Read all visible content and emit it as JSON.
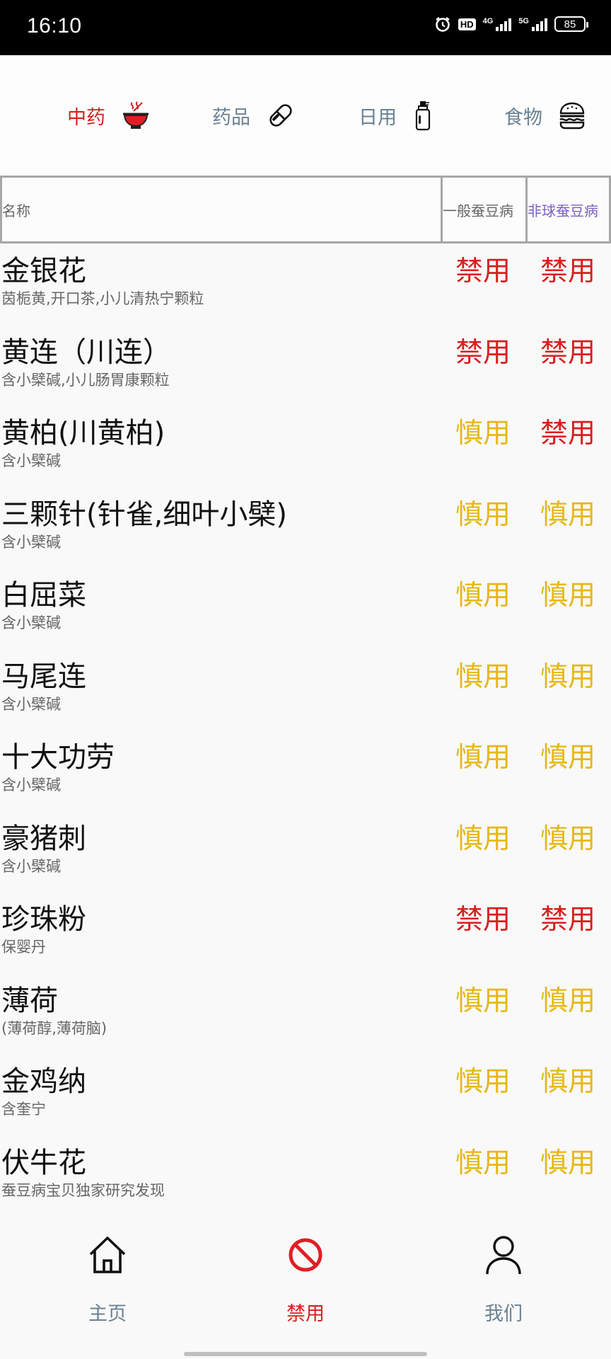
{
  "status": {
    "time": "16:10",
    "hd": "HD",
    "net1": "4G",
    "net2": "5G",
    "battery": "85"
  },
  "categories": [
    {
      "label": "中药",
      "icon": "herbal-bowl-icon",
      "color": "#d61f1f"
    },
    {
      "label": "药品",
      "icon": "pill-capsule-icon",
      "color": "#6a8193"
    },
    {
      "label": "日用",
      "icon": "spray-bottle-icon",
      "color": "#6a8193"
    },
    {
      "label": "食物",
      "icon": "burger-icon",
      "color": "#6a8193"
    }
  ],
  "table_header": {
    "name": "名称",
    "col1": "一般蚕豆病",
    "col2": "非球蚕豆病"
  },
  "colors": {
    "forbidden": "#d81e1e",
    "caution": "#e6b818",
    "col2_header": "#7a5fc7",
    "nav_inactive": "#6a8193",
    "nav_active": "#d61f1f"
  },
  "rows": [
    {
      "name": "金银花",
      "sub": "茵栀黄,开口茶,小儿清热宁颗粒",
      "c1": "禁用",
      "c2": "禁用"
    },
    {
      "name": "黄连（川连）",
      "sub": "含小檗碱,小儿肠胃康颗粒",
      "c1": "禁用",
      "c2": "禁用"
    },
    {
      "name": "黄柏(川黄柏)",
      "sub": "含小檗碱",
      "c1": "慎用",
      "c2": "禁用"
    },
    {
      "name": "三颗针(针雀,细叶小檗)",
      "sub": "含小檗碱",
      "c1": "慎用",
      "c2": "慎用"
    },
    {
      "name": "白屈菜",
      "sub": "含小檗碱",
      "c1": "慎用",
      "c2": "慎用"
    },
    {
      "name": "马尾连",
      "sub": "含小檗碱",
      "c1": "慎用",
      "c2": "慎用"
    },
    {
      "name": "十大功劳",
      "sub": "含小檗碱",
      "c1": "慎用",
      "c2": "慎用"
    },
    {
      "name": "豪猪刺",
      "sub": "含小檗碱",
      "c1": "慎用",
      "c2": "慎用"
    },
    {
      "name": "珍珠粉",
      "sub": "保婴丹",
      "c1": "禁用",
      "c2": "禁用"
    },
    {
      "name": "薄荷",
      "sub": "(薄荷醇,薄荷脑)",
      "c1": "慎用",
      "c2": "慎用"
    },
    {
      "name": "金鸡纳",
      "sub": "含奎宁",
      "c1": "慎用",
      "c2": "慎用"
    },
    {
      "name": "伏牛花",
      "sub": "蚕豆病宝贝独家研究发现",
      "c1": "慎用",
      "c2": "慎用"
    }
  ],
  "nav": [
    {
      "label": "主页",
      "icon": "home-icon"
    },
    {
      "label": "禁用",
      "icon": "prohibited-icon"
    },
    {
      "label": "我们",
      "icon": "user-icon"
    }
  ]
}
